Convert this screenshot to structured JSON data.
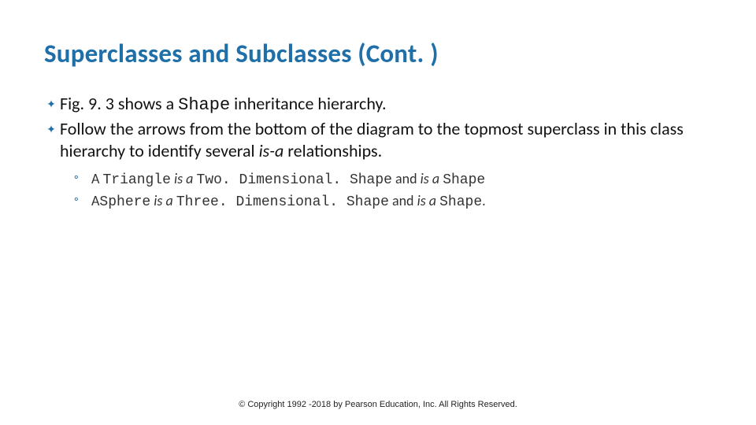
{
  "title": "Superclasses and Subclasses (Cont. )",
  "bullets": [
    {
      "pre": "Fig. 9. 3 shows a ",
      "code": "Shape",
      "post": " inheritance hierarchy."
    },
    {
      "pre": "Follow the arrows from the bottom of the diagram to the topmost superclass in this class hierarchy to identify several ",
      "ital": "is-a",
      "post": " relationships."
    }
  ],
  "subs": [
    {
      "segs": [
        {
          "t": "A ",
          "cls": ""
        },
        {
          "t": "Triangle",
          "cls": "mono"
        },
        {
          "t": " is a ",
          "cls": "ital"
        },
        {
          "t": "Two. Dimensional. Shape",
          "cls": "mono"
        },
        {
          "t": " and ",
          "cls": ""
        },
        {
          "t": "is a ",
          "cls": "ital"
        },
        {
          "t": "Shape",
          "cls": "mono"
        }
      ]
    },
    {
      "segs": [
        {
          "t": "A",
          "cls": ""
        },
        {
          "t": "Sphere",
          "cls": "mono"
        },
        {
          "t": " is a ",
          "cls": "ital"
        },
        {
          "t": "Three. Dimensional. Shape",
          "cls": "mono"
        },
        {
          "t": " and ",
          "cls": ""
        },
        {
          "t": "is a ",
          "cls": "ital"
        },
        {
          "t": "Shape",
          "cls": "mono"
        },
        {
          "t": ".",
          "cls": ""
        }
      ]
    }
  ],
  "footer": "© Copyright 1992 -2018 by Pearson Education, Inc. All Rights Reserved."
}
